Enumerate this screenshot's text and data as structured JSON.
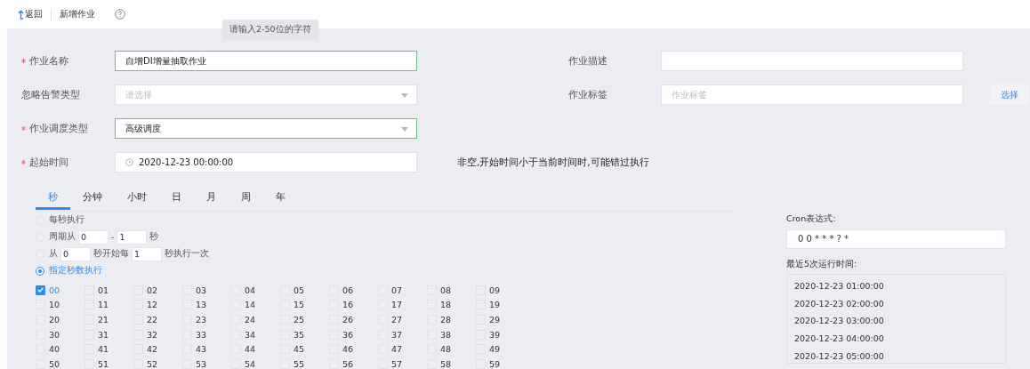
{
  "header": {
    "back": "返回",
    "title": "新增作业"
  },
  "tooltip": "请输入2-50位的字符",
  "form_rows": [
    {
      "left": {
        "kind": "input",
        "label": "作业名称",
        "required": true,
        "value": "自增DI增量抽取作业",
        "valid": true
      },
      "right": {
        "kind": "input",
        "label": "作业描述",
        "required": false,
        "valid": false
      }
    },
    {
      "left": {
        "kind": "select",
        "label": "忽略告警类型",
        "required": false,
        "placeholder": "请选择",
        "valid": false
      },
      "right": {
        "kind": "input",
        "label": "作业标签",
        "required": false,
        "placeholder": "作业标签",
        "valid": false,
        "button": "选择"
      }
    },
    {
      "left": {
        "kind": "select",
        "label": "作业调度类型",
        "required": true,
        "value": "高级调度",
        "valid": true
      }
    },
    {
      "left": {
        "kind": "datetime",
        "label": "起始时间",
        "required": true,
        "value": "2020-12-23 00:00:00",
        "valid": false
      },
      "hint": "非空,开始时间小于当前时间时,可能错过执行"
    }
  ],
  "schedule_tabs": [
    {
      "label": "秒",
      "selected": true
    },
    {
      "label": "分钟",
      "selected": false
    },
    {
      "label": "小时",
      "selected": false
    },
    {
      "label": "日",
      "selected": false
    },
    {
      "label": "月",
      "selected": false
    },
    {
      "label": "周",
      "selected": false
    },
    {
      "label": "年",
      "selected": false
    }
  ],
  "options": [
    {
      "selected": false,
      "parts": [
        {
          "kind": "text",
          "text": "每秒执行"
        }
      ]
    },
    {
      "selected": false,
      "parts": [
        {
          "kind": "text",
          "text": "周期从"
        },
        {
          "kind": "input",
          "value": "0"
        },
        {
          "kind": "text",
          "text": "-"
        },
        {
          "kind": "input",
          "value": "1"
        },
        {
          "kind": "text",
          "text": "秒"
        }
      ]
    },
    {
      "selected": false,
      "parts": [
        {
          "kind": "text",
          "text": "从"
        },
        {
          "kind": "input",
          "value": "0"
        },
        {
          "kind": "text",
          "text": "秒开始每"
        },
        {
          "kind": "input",
          "value": "1"
        },
        {
          "kind": "text",
          "text": "秒执行一次"
        }
      ]
    },
    {
      "selected": true,
      "parts": [
        {
          "kind": "text",
          "text": "指定秒数执行"
        }
      ]
    }
  ],
  "seconds": [
    {
      "label": "00",
      "checked": true
    },
    {
      "label": "01",
      "checked": false
    },
    {
      "label": "02",
      "checked": false
    },
    {
      "label": "03",
      "checked": false
    },
    {
      "label": "04",
      "checked": false
    },
    {
      "label": "05",
      "checked": false
    },
    {
      "label": "06",
      "checked": false
    },
    {
      "label": "07",
      "checked": false
    },
    {
      "label": "08",
      "checked": false
    },
    {
      "label": "09",
      "checked": false
    },
    {
      "label": "10",
      "checked": false
    },
    {
      "label": "11",
      "checked": false
    },
    {
      "label": "12",
      "checked": false
    },
    {
      "label": "13",
      "checked": false
    },
    {
      "label": "14",
      "checked": false
    },
    {
      "label": "15",
      "checked": false
    },
    {
      "label": "16",
      "checked": false
    },
    {
      "label": "17",
      "checked": false
    },
    {
      "label": "18",
      "checked": false
    },
    {
      "label": "19",
      "checked": false
    },
    {
      "label": "20",
      "checked": false
    },
    {
      "label": "21",
      "checked": false
    },
    {
      "label": "22",
      "checked": false
    },
    {
      "label": "23",
      "checked": false
    },
    {
      "label": "24",
      "checked": false
    },
    {
      "label": "25",
      "checked": false
    },
    {
      "label": "26",
      "checked": false
    },
    {
      "label": "27",
      "checked": false
    },
    {
      "label": "28",
      "checked": false
    },
    {
      "label": "29",
      "checked": false
    },
    {
      "label": "30",
      "checked": false
    },
    {
      "label": "31",
      "checked": false
    },
    {
      "label": "32",
      "checked": false
    },
    {
      "label": "33",
      "checked": false
    },
    {
      "label": "34",
      "checked": false
    },
    {
      "label": "35",
      "checked": false
    },
    {
      "label": "36",
      "checked": false
    },
    {
      "label": "37",
      "checked": false
    },
    {
      "label": "38",
      "checked": false
    },
    {
      "label": "39",
      "checked": false
    },
    {
      "label": "40",
      "checked": false
    },
    {
      "label": "41",
      "checked": false
    },
    {
      "label": "42",
      "checked": false
    },
    {
      "label": "43",
      "checked": false
    },
    {
      "label": "44",
      "checked": false
    },
    {
      "label": "45",
      "checked": false
    },
    {
      "label": "46",
      "checked": false
    },
    {
      "label": "47",
      "checked": false
    },
    {
      "label": "48",
      "checked": false
    },
    {
      "label": "49",
      "checked": false
    },
    {
      "label": "50",
      "checked": false
    },
    {
      "label": "51",
      "checked": false
    },
    {
      "label": "52",
      "checked": false
    },
    {
      "label": "53",
      "checked": false
    },
    {
      "label": "54",
      "checked": false
    },
    {
      "label": "55",
      "checked": false
    },
    {
      "label": "56",
      "checked": false
    },
    {
      "label": "57",
      "checked": false
    },
    {
      "label": "58",
      "checked": false
    },
    {
      "label": "59",
      "checked": false
    }
  ],
  "cron": {
    "label": "Cron表达式:",
    "value": "0 0 * * * ? *",
    "recent_label": "最近5次运行时间:",
    "recent_times": [
      "2020-12-23 01:00:00",
      "2020-12-23 02:00:00",
      "2020-12-23 03:00:00",
      "2020-12-23 04:00:00",
      "2020-12-23 05:00:00"
    ]
  }
}
